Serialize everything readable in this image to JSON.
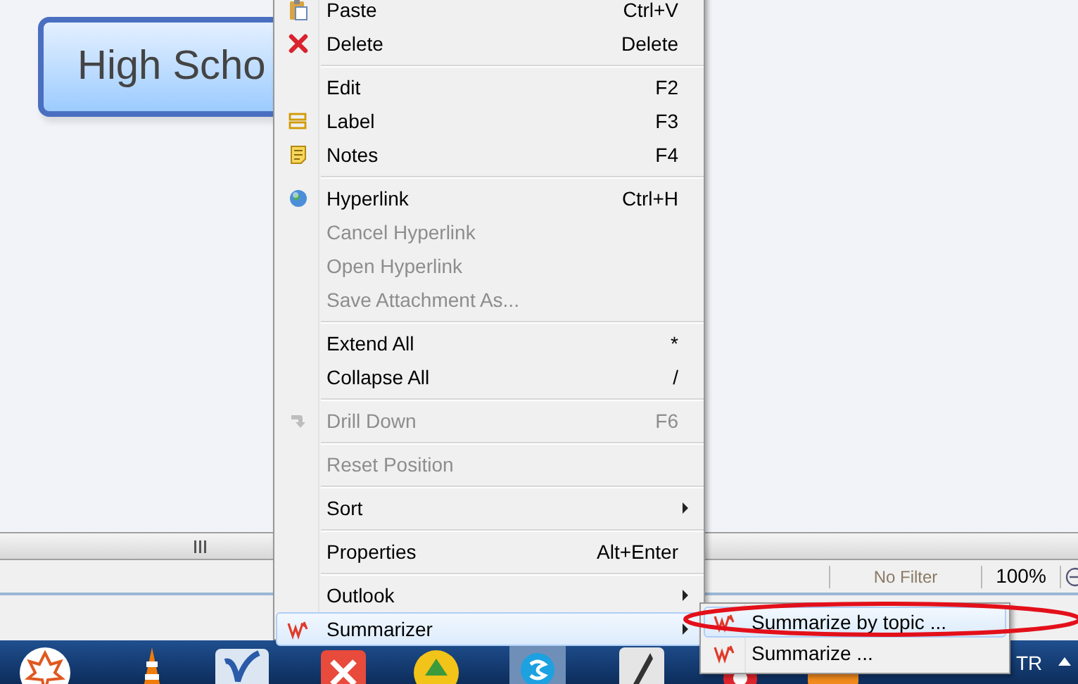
{
  "canvas": {
    "topic": "High Scho"
  },
  "status_bar": {
    "filter": "No Filter",
    "zoom": "100%"
  },
  "context_menu": {
    "items": [
      {
        "kind": "item",
        "label": "Paste",
        "shortcut": "Ctrl+V",
        "disabled": false,
        "submenu": false,
        "selected": false
      },
      {
        "kind": "item",
        "label": "Delete",
        "shortcut": "Delete",
        "disabled": false,
        "submenu": false,
        "selected": false
      },
      {
        "kind": "separator"
      },
      {
        "kind": "item",
        "label": "Edit",
        "shortcut": "F2",
        "disabled": false,
        "submenu": false,
        "selected": false
      },
      {
        "kind": "item",
        "label": "Label",
        "shortcut": "F3",
        "disabled": false,
        "submenu": false,
        "selected": false
      },
      {
        "kind": "item",
        "label": "Notes",
        "shortcut": "F4",
        "disabled": false,
        "submenu": false,
        "selected": false
      },
      {
        "kind": "separator"
      },
      {
        "kind": "item",
        "label": "Hyperlink",
        "shortcut": "Ctrl+H",
        "disabled": false,
        "submenu": false,
        "selected": false
      },
      {
        "kind": "item",
        "label": "Cancel Hyperlink",
        "disabled": true,
        "submenu": false,
        "selected": false
      },
      {
        "kind": "item",
        "label": "Open Hyperlink",
        "disabled": true,
        "submenu": false,
        "selected": false
      },
      {
        "kind": "item",
        "label": "Save Attachment As...",
        "disabled": true,
        "submenu": false,
        "selected": false
      },
      {
        "kind": "separator"
      },
      {
        "kind": "item",
        "label": "Extend All",
        "shortcut": "*",
        "disabled": false,
        "submenu": false,
        "selected": false
      },
      {
        "kind": "item",
        "label": "Collapse All",
        "shortcut": "/",
        "disabled": false,
        "submenu": false,
        "selected": false
      },
      {
        "kind": "separator"
      },
      {
        "kind": "item",
        "label": "Drill Down",
        "shortcut": "F6",
        "disabled": true,
        "submenu": false,
        "selected": false
      },
      {
        "kind": "separator"
      },
      {
        "kind": "item",
        "label": "Reset Position",
        "disabled": true,
        "submenu": false,
        "selected": false
      },
      {
        "kind": "separator"
      },
      {
        "kind": "item",
        "label": "Sort",
        "disabled": false,
        "submenu": true,
        "selected": false
      },
      {
        "kind": "separator"
      },
      {
        "kind": "item",
        "label": "Properties",
        "shortcut": "Alt+Enter",
        "disabled": false,
        "submenu": false,
        "selected": false
      },
      {
        "kind": "separator"
      },
      {
        "kind": "item",
        "label": "Outlook",
        "disabled": false,
        "submenu": true,
        "selected": false
      },
      {
        "kind": "item",
        "label": "Summarizer",
        "disabled": false,
        "submenu": true,
        "selected": true
      }
    ]
  },
  "submenu": {
    "items": [
      {
        "label": "Summarize by topic ...",
        "selected": true
      },
      {
        "label": "Summarize ...",
        "selected": false
      }
    ]
  },
  "taskbar": {
    "language": "TR"
  }
}
